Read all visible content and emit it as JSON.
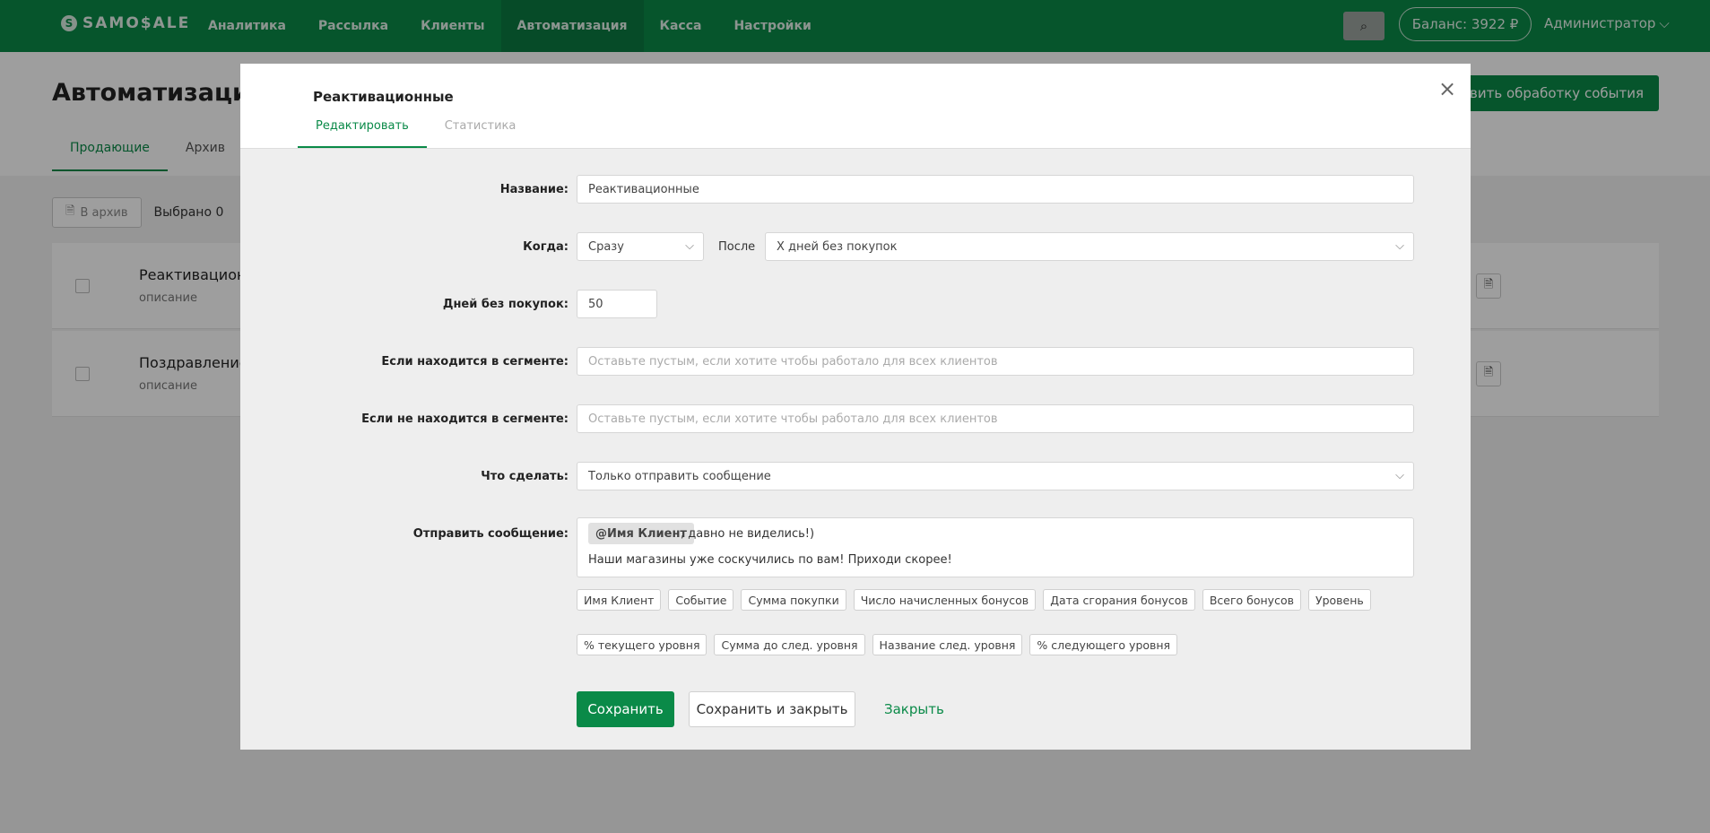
{
  "brand": {
    "name": "SAMO$ALE",
    "mark": "S"
  },
  "nav": {
    "items": [
      "Аналитика",
      "Рассылка",
      "Клиенты",
      "Автоматизация",
      "Касса",
      "Настройки"
    ],
    "active": "Автоматизация"
  },
  "header": {
    "search_icon": "⌕",
    "balance": "Баланс: 3922 ₽",
    "user": "Администратор",
    "user_chevron": "⌵"
  },
  "page": {
    "title": "Автоматизация",
    "add_button": "Добавить обработку события",
    "tabs": [
      "Продающие",
      "Архив"
    ],
    "archive_button": "В архив",
    "selected": "Выбрано 0",
    "rows": [
      {
        "name": "Реактивационные",
        "desc": "описание"
      },
      {
        "name": "Поздравление",
        "desc": "описание"
      }
    ]
  },
  "modal": {
    "title": "Реактивационные",
    "tabs": [
      "Редактировать",
      "Статистика"
    ],
    "close": "×",
    "fields": {
      "name_label": "Название:",
      "name_value": "Реактивационные",
      "when_label": "Когда:",
      "when_value": "Сразу",
      "after_label": "После",
      "after_value": "Х дней без покупок",
      "days_label": "Дней без покупок:",
      "days_value": "50",
      "in_segment_label": "Если находится в сегменте:",
      "in_segment_placeholder": "Оставьте пустым, если хотите чтобы работало для всех клиентов",
      "not_in_segment_label": "Если не находится в сегменте:",
      "not_in_segment_placeholder": "Оставьте пустым, если хотите чтобы работало для всех клиентов",
      "action_label": "Что сделать:",
      "action_value": "Только отправить сообщение",
      "message_label": "Отправить сообщение:"
    },
    "message": {
      "mention": "@Имя Клиент",
      "line1": ", давно не виделись!)",
      "line2": "Наши магазины уже соскучились по вам! Приходи скорее!"
    },
    "variables_row1": [
      "Имя Клиент",
      "Событие",
      "Сумма покупки",
      "Число начисленных бонусов",
      "Дата сгорания бонусов",
      "Всего бонусов",
      "Уровень"
    ],
    "variables_row2": [
      "% текущего уровня",
      "Сумма до след. уровня",
      "Название след. уровня",
      "% следующего уровня"
    ],
    "buttons": {
      "save": "Сохранить",
      "save_close": "Сохранить и закрыть",
      "close": "Закрыть"
    }
  },
  "colors": {
    "brand_green": "#0a8a48"
  }
}
